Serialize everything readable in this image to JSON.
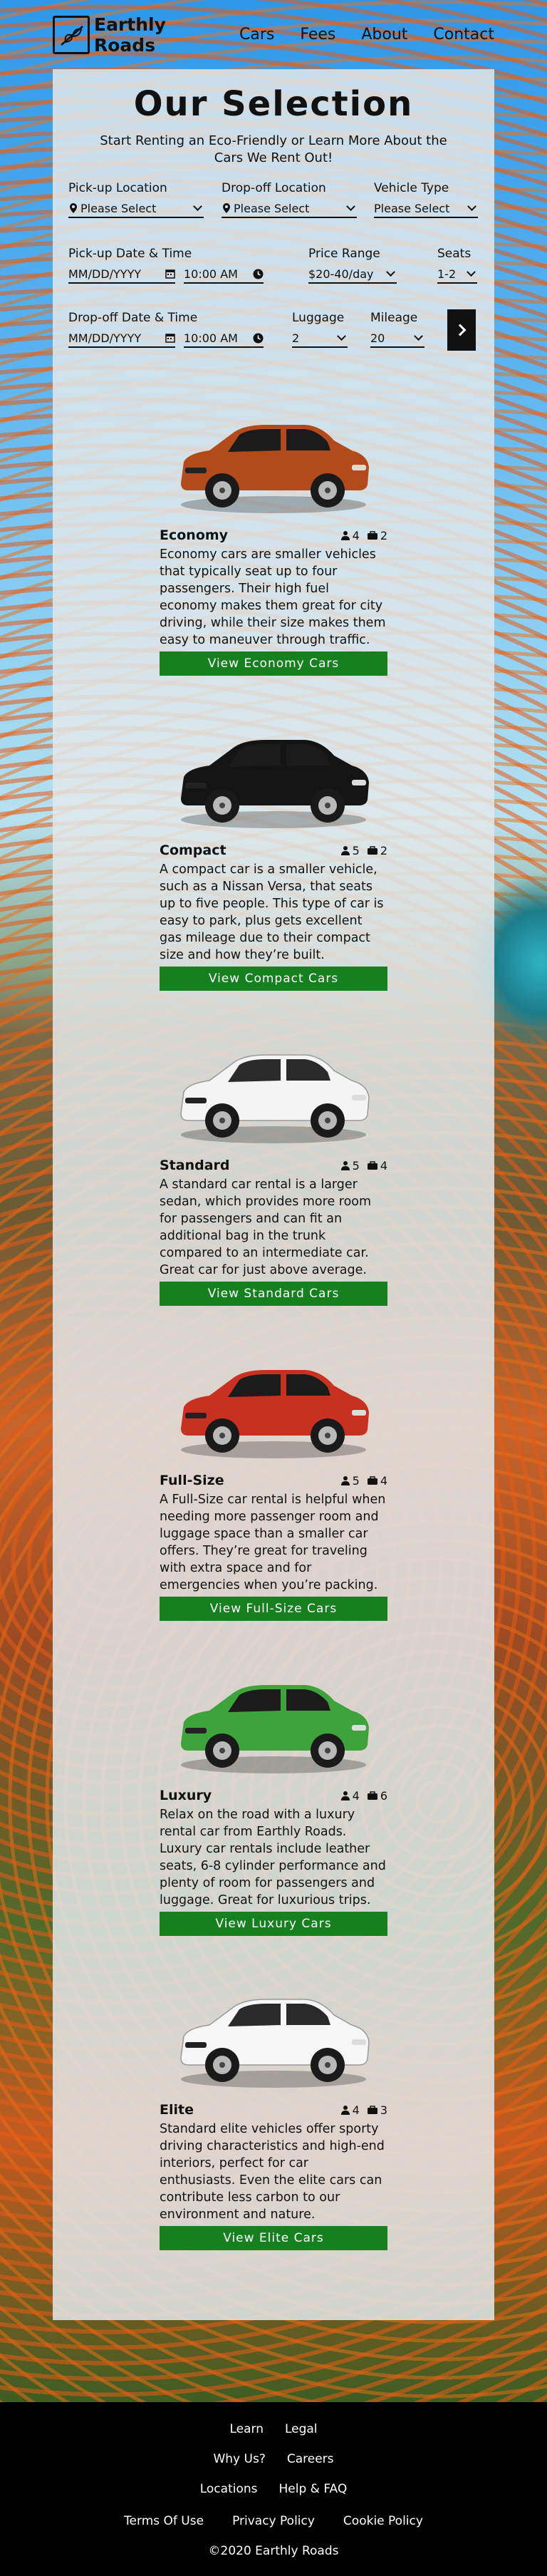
{
  "header": {
    "brand_line1": "Earthly",
    "brand_line2": "Roads",
    "nav": [
      "Cars",
      "Fees",
      "About",
      "Contact"
    ]
  },
  "title": "Our Selection",
  "subtitle": "Start Renting an Eco-Friendly or Learn More About the Cars We Rent Out!",
  "form": {
    "pickup_location": {
      "label": "Pick-up Location",
      "value": "Please Select"
    },
    "dropoff_location": {
      "label": "Drop-off Location",
      "value": "Please Select"
    },
    "vehicle_type": {
      "label": "Vehicle Type",
      "value": "Please Select"
    },
    "pickup_datetime": {
      "label": "Pick-up Date & Time",
      "date": "MM/DD/YYYY",
      "time": "10:00 AM"
    },
    "price_range": {
      "label": "Price Range",
      "value": "$20-40/day"
    },
    "seats": {
      "label": "Seats",
      "value": "1-2"
    },
    "dropoff_datetime": {
      "label": "Drop-off Date & Time",
      "date": "MM/DD/YYYY",
      "time": "10:00 AM"
    },
    "luggage": {
      "label": "Luggage",
      "value": "2"
    },
    "mileage": {
      "label": "Mileage",
      "value": "20"
    }
  },
  "cars": [
    {
      "name": "Economy",
      "seats": "4",
      "bags": "2",
      "color": "#b24a1b",
      "desc": "Economy cars are smaller vehicles that typically seat up to four passengers. Their high fuel economy makes them great for city driving, while their size makes them easy to maneuver through traffic.",
      "button": "View Economy Cars"
    },
    {
      "name": "Compact",
      "seats": "5",
      "bags": "2",
      "color": "#141414",
      "desc": "A compact car is a smaller vehicle, such as a Nissan Versa, that seats up to five people. This type of car is easy to park, plus gets excellent gas mileage due to their compact size and how they’re built.",
      "button": "View Compact Cars"
    },
    {
      "name": "Standard",
      "seats": "5",
      "bags": "4",
      "color": "#f4f4f4",
      "desc": "A standard car rental is a larger sedan, which provides more room for passengers and can fit an additional bag in the trunk compared to an intermediate car. Great car for just above average.",
      "button": "View Standard Cars"
    },
    {
      "name": "Full-Size",
      "seats": "5",
      "bags": "4",
      "color": "#c8301f",
      "desc": "A Full-Size car rental is helpful when needing more passenger room and luggage space than a smaller car offers. They’re great for traveling with extra space and for emergencies when you’re packing.",
      "button": "View Full-Size Cars"
    },
    {
      "name": "Luxury",
      "seats": "4",
      "bags": "6",
      "color": "#3ea33a",
      "desc": "Relax on the road with a luxury rental car from Earthly Roads. Luxury car rentals include leather seats, 6-8 cylinder performance and plenty of room for passengers and luggage. Great for luxurious trips.",
      "button": "View Luxury Cars"
    },
    {
      "name": "Elite",
      "seats": "4",
      "bags": "3",
      "color": "#f6f6f6",
      "desc": "Standard elite vehicles offer sporty driving characteristics and high-end interiors, perfect for car enthusiasts. Even the elite cars can contribute less carbon to our environment and nature.",
      "button": "View Elite Cars"
    }
  ],
  "footer": {
    "row1": [
      "Learn",
      "Legal"
    ],
    "row2": [
      "Why Us?",
      "Careers"
    ],
    "row3": [
      "Locations",
      "Help & FAQ"
    ],
    "row4": [
      "Terms Of Use",
      "Privacy Policy",
      "Cookie Policy"
    ],
    "copyright": "©2020 Earthly Roads"
  }
}
